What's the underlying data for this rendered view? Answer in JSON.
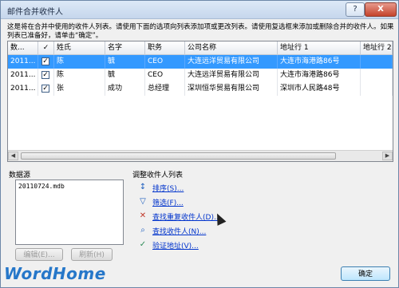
{
  "window": {
    "title": "邮件合并收件人",
    "help_label": "?",
    "close_label": "X"
  },
  "description": "这是将在合并中使用的收件人列表。请使用下面的选项向列表添加项或更改列表。请使用复选框来添加或删除合并的收件人。如果列表已准备好，请单击“确定”。",
  "table": {
    "headers": [
      "数...",
      "✓",
      "姓氏",
      "名字",
      "职务",
      "公司名称",
      "地址行 1",
      "地址行 2"
    ],
    "rows": [
      {
        "source": "2011...",
        "checked": "✓",
        "last": "陈",
        "first": "毓",
        "title": "CEO",
        "company": "大连远洋贸易有限公司",
        "address1": "大连市海港路86号",
        "address2": ""
      },
      {
        "source": "2011...",
        "checked": "✓",
        "last": "陈",
        "first": "毓",
        "title": "CEO",
        "company": "大连远洋贸易有限公司",
        "address1": "大连市海港路86号",
        "address2": ""
      },
      {
        "source": "2011...",
        "checked": "✓",
        "last": "张",
        "first": "成功",
        "title": "总经理",
        "company": "深圳恒华贸易有限公司",
        "address1": "深圳市人民路48号",
        "address2": ""
      }
    ]
  },
  "datasource": {
    "label": "数据源",
    "items": [
      "20110724.mdb"
    ],
    "edit_button": "编辑(E)...",
    "refresh_button": "刷新(H)"
  },
  "refine": {
    "label": "调整收件人列表",
    "links": [
      {
        "icon": "sort-icon",
        "glyph": "↕",
        "label": "排序(S)..."
      },
      {
        "icon": "filter-icon",
        "glyph": "▽",
        "label": "筛选(F)..."
      },
      {
        "icon": "find-duplicates-icon",
        "glyph": "✕",
        "label": "查找重复收件人(D)..."
      },
      {
        "icon": "find-recipient-icon",
        "glyph": "⌕",
        "label": "查找收件人(N)..."
      },
      {
        "icon": "validate-address-icon",
        "glyph": "✓",
        "label": "验证地址(V)..."
      }
    ]
  },
  "footer": {
    "ok_button": "确定"
  },
  "watermark": "WordHome"
}
